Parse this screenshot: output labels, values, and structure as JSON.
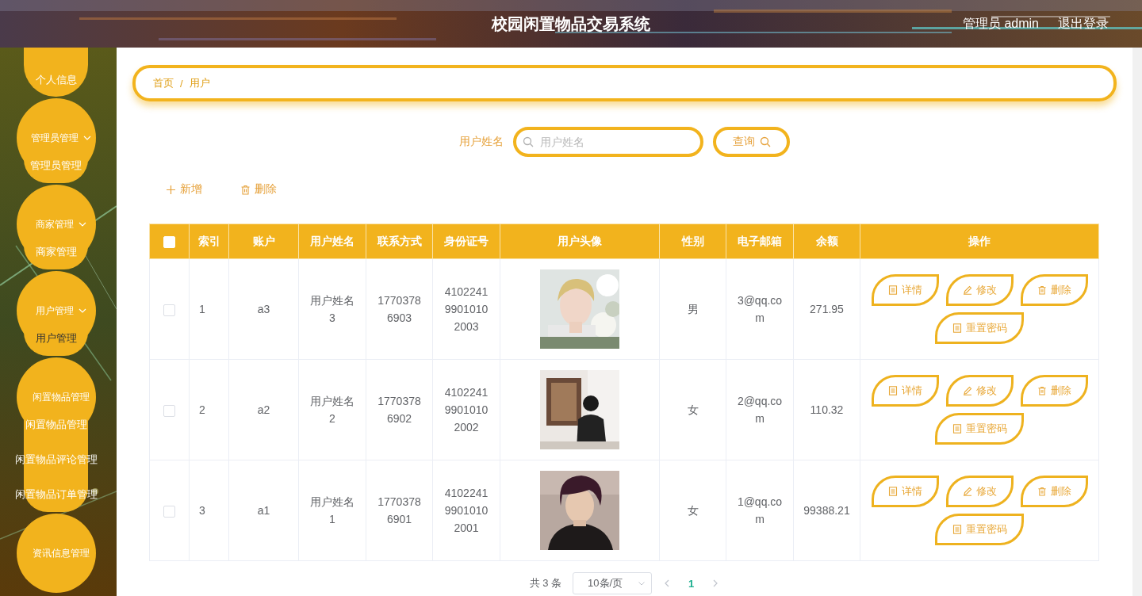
{
  "header": {
    "title": "校园闲置物品交易系统",
    "user_label": "管理员 admin",
    "logout": "退出登录"
  },
  "sidebar": {
    "items": [
      {
        "kind": "item",
        "label": "个人信息"
      },
      {
        "kind": "group",
        "label": "管理员管理",
        "arrow": true,
        "children": [
          {
            "label": "管理员管理",
            "selected": false
          }
        ]
      },
      {
        "kind": "group",
        "label": "商家管理",
        "arrow": true,
        "children": [
          {
            "label": "商家管理",
            "selected": false
          }
        ]
      },
      {
        "kind": "group",
        "label": "用户管理",
        "arrow": true,
        "children": [
          {
            "label": "用户管理",
            "selected": true
          }
        ]
      },
      {
        "kind": "group",
        "label": "闲置物品管理",
        "arrow": false,
        "children": [
          {
            "label": "闲置物品管理",
            "selected": false
          },
          {
            "label": "闲置物品评论管理",
            "selected": false
          },
          {
            "label": "闲置物品订单管理",
            "selected": false
          }
        ]
      },
      {
        "kind": "group",
        "label": "资讯信息管理",
        "arrow": false
      }
    ]
  },
  "breadcrumb": {
    "items": [
      "首页",
      "用户"
    ],
    "separator": "/"
  },
  "search": {
    "label": "用户姓名",
    "placeholder": "用户姓名",
    "button": "查询"
  },
  "actions": [
    {
      "kind": "add",
      "label": "新增"
    },
    {
      "kind": "delete",
      "label": "删除"
    }
  ],
  "table": {
    "select_all_checked": false,
    "columns": [
      "索引",
      "账户",
      "用户姓名",
      "联系方式",
      "身份证号",
      "用户头像",
      "性别",
      "电子邮箱",
      "余额",
      "操作"
    ],
    "rows": [
      {
        "checked": false,
        "cells": [
          "1",
          "a3",
          "用户姓名3",
          "17703786903",
          "410224199010102003"
        ],
        "avatar": {
          "kind": "picture"
        },
        "cells_after": [
          "男",
          "3@qq.com",
          "271.95"
        ],
        "actions": [
          {
            "kind": "detail",
            "label": "详情"
          },
          {
            "kind": "edit",
            "label": "修改"
          },
          {
            "kind": "delete",
            "label": "删除"
          },
          {
            "kind": "reset",
            "label": "重置密码"
          }
        ]
      },
      {
        "checked": false,
        "cells": [
          "2",
          "a2",
          "用户姓名2",
          "17703786902",
          "410224199010102002"
        ],
        "avatar": {
          "kind": "picture"
        },
        "cells_after": [
          "女",
          "2@qq.com",
          "110.32"
        ],
        "actions": [
          {
            "kind": "detail",
            "label": "详情"
          },
          {
            "kind": "edit",
            "label": "修改"
          },
          {
            "kind": "delete",
            "label": "删除"
          },
          {
            "kind": "reset",
            "label": "重置密码"
          }
        ]
      },
      {
        "checked": false,
        "cells": [
          "3",
          "a1",
          "用户姓名1",
          "17703786901",
          "410224199010102001"
        ],
        "avatar": {
          "kind": "picture"
        },
        "cells_after": [
          "女",
          "1@qq.com",
          "99388.21"
        ],
        "actions": [
          {
            "kind": "detail",
            "label": "详情"
          },
          {
            "kind": "edit",
            "label": "修改"
          },
          {
            "kind": "delete",
            "label": "删除"
          },
          {
            "kind": "reset",
            "label": "重置密码"
          }
        ]
      }
    ]
  },
  "pagination": {
    "total": "共 3 条",
    "page_size": "10条/页",
    "pages": [
      {
        "label": "1",
        "selected": true
      }
    ]
  }
}
